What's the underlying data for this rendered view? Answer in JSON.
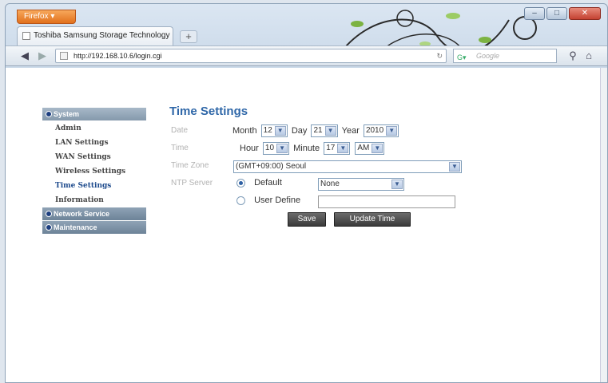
{
  "browser": {
    "menu_label": "Firefox ▾",
    "tab_title": "Toshiba Samsung Storage Technology",
    "url": "http://192.168.10.6/login.cgi",
    "search_placeholder": "Google",
    "window_controls": [
      "minimize-icon",
      "maximize-icon",
      "close-icon"
    ]
  },
  "sidebar": {
    "sections": [
      {
        "label": "System",
        "items": [
          "Admin",
          "LAN Settings",
          "WAN Settings",
          "Wireless Settings",
          "Time Settings",
          "Information"
        ]
      },
      {
        "label": "Network Service",
        "items": []
      },
      {
        "label": "Maintenance",
        "items": []
      }
    ],
    "current_item": "Time Settings"
  },
  "main": {
    "title": "Time Settings",
    "date": {
      "label": "Date",
      "month_label": "Month",
      "month_value": "12",
      "day_label": "Day",
      "day_value": "21",
      "year_label": "Year",
      "year_value": "2010"
    },
    "time": {
      "label": "Time",
      "hour_label": "Hour",
      "hour_value": "10",
      "minute_label": "Minute",
      "minute_value": "17",
      "ampm_value": "AM"
    },
    "timezone": {
      "label": "Time Zone",
      "value": "(GMT+09:00) Seoul"
    },
    "ntp": {
      "label": "NTP Server",
      "default_label": "Default",
      "default_value": "None",
      "user_define_label": "User Define",
      "user_define_value": ""
    },
    "buttons": {
      "save": "Save",
      "update_time": "Update Time"
    }
  },
  "colors": {
    "accent": "#2f67a8",
    "sidebar_header": "#7a8fa3",
    "button": "#4a4a4a"
  }
}
